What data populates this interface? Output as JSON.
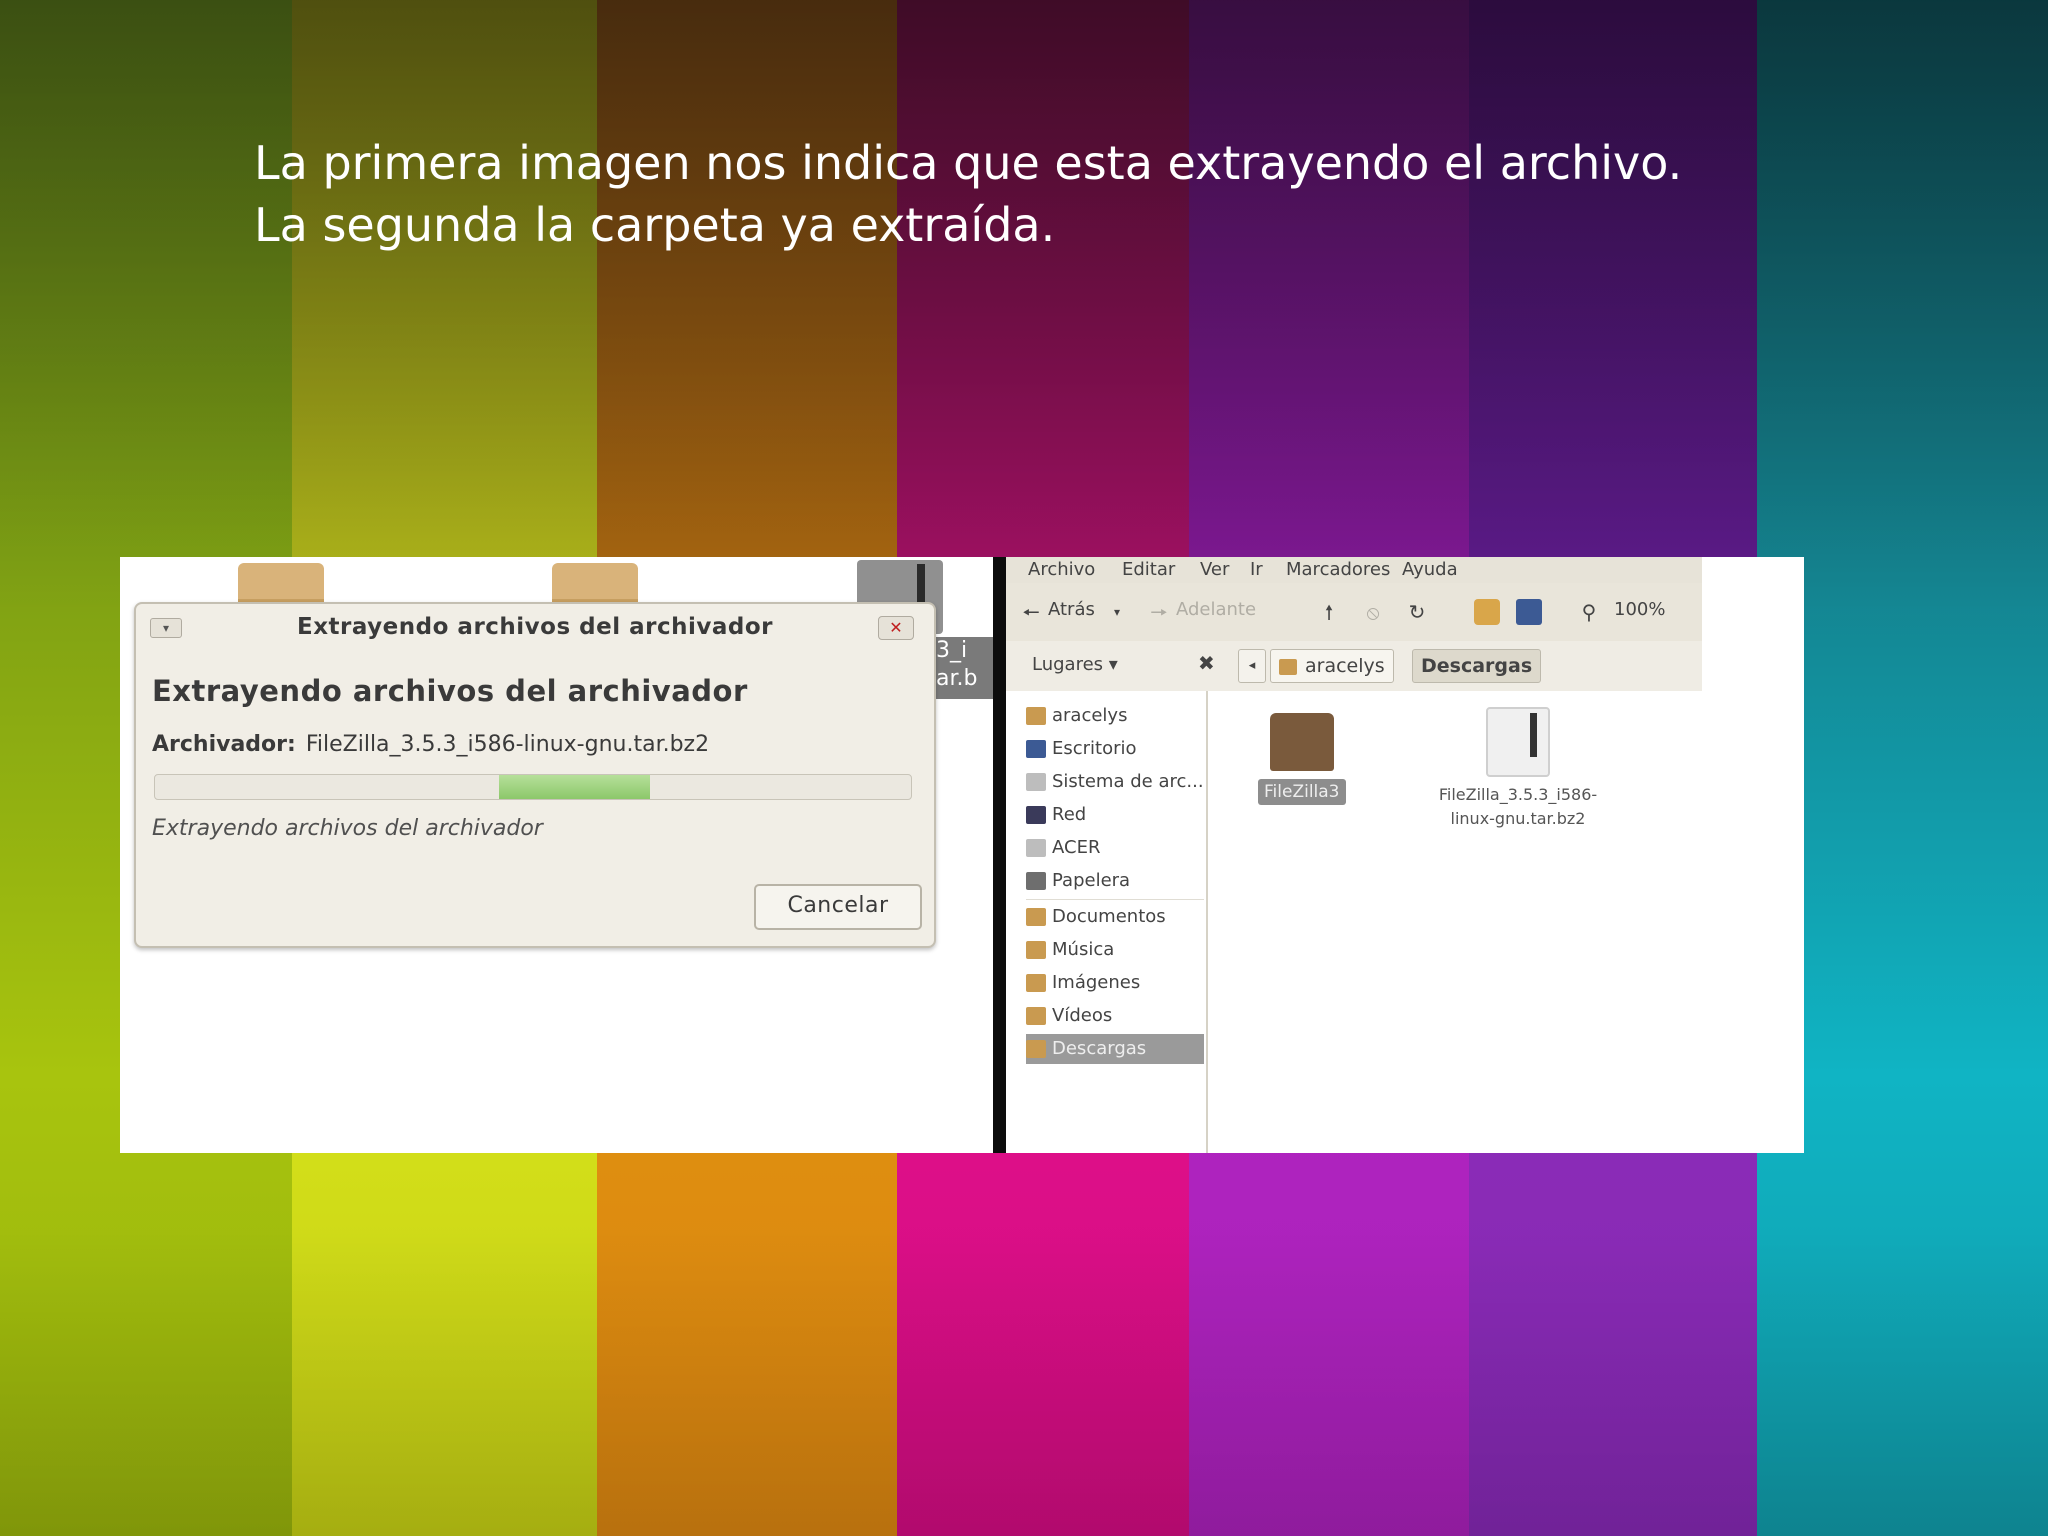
{
  "slide": {
    "line1": "La primera imagen nos indica que esta extrayendo el archivo.",
    "line2": "La segunda la carpeta ya extraída."
  },
  "desktop_cut": {
    "line1": "3_i",
    "line2": "ar.b"
  },
  "dialog": {
    "title": "Extrayendo archivos del archivador",
    "heading": "Extrayendo archivos del archivador",
    "archive_label": "Archivador:",
    "archive_value": "FileZilla_3.5.3_i586-linux-gnu.tar.bz2",
    "status": "Extrayendo archivos del archivador",
    "cancel_label": "Cancelar",
    "close_icon": "✕",
    "menu_icon": "▾",
    "progress_fraction": 0.2
  },
  "file_manager": {
    "menu": [
      "Archivo",
      "Editar",
      "Ver",
      "Ir",
      "Marcadores",
      "Ayuda"
    ],
    "toolbar": {
      "back": "Atrás",
      "forward": "Adelante",
      "zoom": "100%"
    },
    "places_label": "Lugares ▾",
    "places_close": "✖",
    "path": [
      "aracelys",
      "Descargas"
    ],
    "sidebar": [
      {
        "label": "aracelys",
        "icon": "folder-icon"
      },
      {
        "label": "Escritorio",
        "icon": "desktop-icon"
      },
      {
        "label": "Sistema de arc...",
        "icon": "drive-icon"
      },
      {
        "label": "Red",
        "icon": "network-icon"
      },
      {
        "label": "ACER",
        "icon": "drive-icon"
      },
      {
        "label": "Papelera",
        "icon": "trash-icon"
      },
      {
        "label": "Documentos",
        "icon": "folder-icon"
      },
      {
        "label": "Música",
        "icon": "folder-icon"
      },
      {
        "label": "Imágenes",
        "icon": "folder-icon"
      },
      {
        "label": "Vídeos",
        "icon": "folder-icon"
      },
      {
        "label": "Descargas",
        "icon": "folder-icon",
        "selected": true
      }
    ],
    "items": {
      "folder": "FileZilla3",
      "archive_line1": "FileZilla_3.5.3_i586-",
      "archive_line2": "linux-gnu.tar.bz2"
    }
  }
}
